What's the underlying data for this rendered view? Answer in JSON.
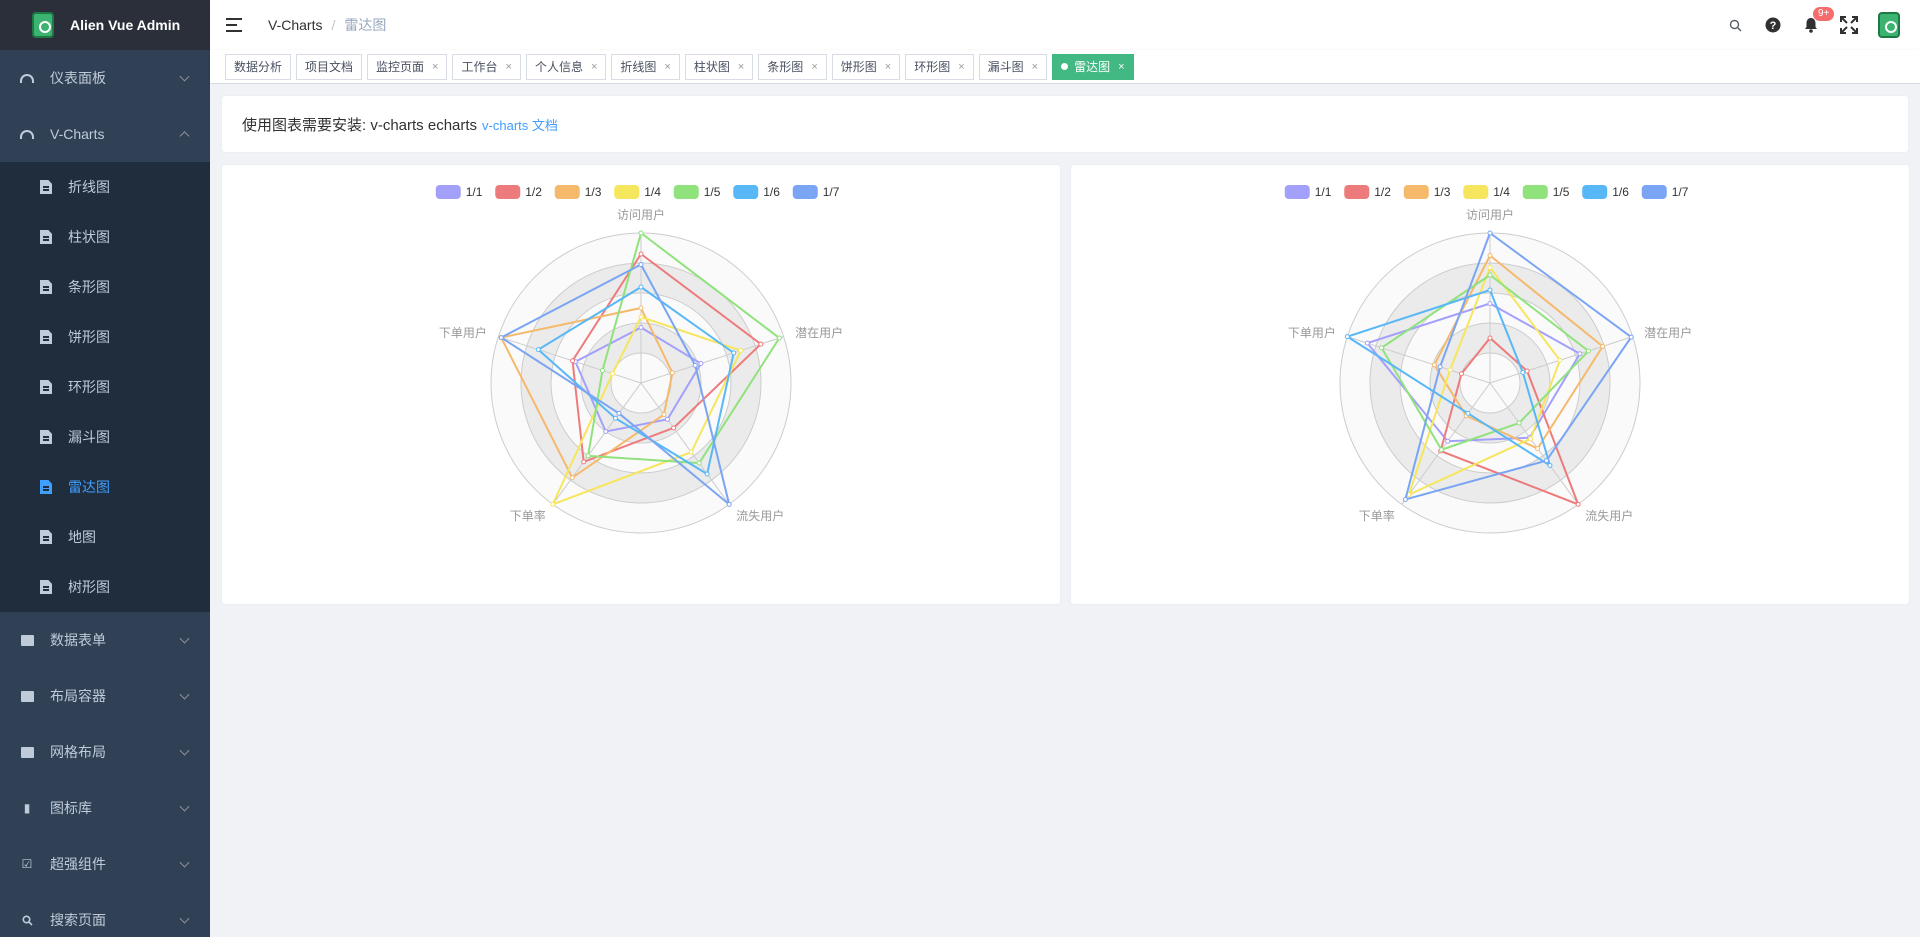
{
  "app": {
    "title": "Alien Vue Admin"
  },
  "sidebar": {
    "groups": [
      {
        "label": "仪表面板",
        "icon": "dashboard-icon",
        "open": false
      },
      {
        "label": "V-Charts",
        "icon": "dashboard-icon",
        "open": true,
        "children": [
          "折线图",
          "柱状图",
          "条形图",
          "饼形图",
          "环形图",
          "漏斗图",
          "雷达图",
          "地图",
          "树形图"
        ]
      },
      {
        "label": "数据表单",
        "icon": "folder-icon",
        "open": false
      },
      {
        "label": "布局容器",
        "icon": "folder-icon",
        "open": false
      },
      {
        "label": "网格布局",
        "icon": "folder-icon",
        "open": false
      },
      {
        "label": "图标库",
        "icon": "icon-library-icon",
        "open": false
      },
      {
        "label": "超强组件",
        "icon": "component-icon",
        "open": false
      },
      {
        "label": "搜索页面",
        "icon": "search-icon",
        "open": false
      }
    ],
    "active_child": "雷达图"
  },
  "header": {
    "breadcrumb": [
      "V-Charts",
      "雷达图"
    ],
    "notification_count": "9+"
  },
  "tags": [
    {
      "label": "数据分析",
      "closable": false,
      "active": false
    },
    {
      "label": "项目文档",
      "closable": false,
      "active": false
    },
    {
      "label": "监控页面",
      "closable": true,
      "active": false
    },
    {
      "label": "工作台",
      "closable": true,
      "active": false
    },
    {
      "label": "个人信息",
      "closable": true,
      "active": false
    },
    {
      "label": "折线图",
      "closable": true,
      "active": false
    },
    {
      "label": "柱状图",
      "closable": true,
      "active": false
    },
    {
      "label": "条形图",
      "closable": true,
      "active": false
    },
    {
      "label": "饼形图",
      "closable": true,
      "active": false
    },
    {
      "label": "环形图",
      "closable": true,
      "active": false
    },
    {
      "label": "漏斗图",
      "closable": true,
      "active": false
    },
    {
      "label": "雷达图",
      "closable": true,
      "active": true
    }
  ],
  "notice": {
    "text": "使用图表需要安装: v-charts echarts",
    "link": "v-charts 文档"
  },
  "chart_data": [
    {
      "type": "radar",
      "indicators": [
        "访问用户",
        "潜在用户",
        "流失用户",
        "下单率",
        "下单用户"
      ],
      "max": 1,
      "legend_position": "top-center",
      "series": [
        {
          "name": "1/1",
          "color": "#a3a0fb",
          "values": [
            0.37,
            0.42,
            0.3,
            0.4,
            0.46
          ]
        },
        {
          "name": "1/2",
          "color": "#ee7b7b",
          "values": [
            0.86,
            0.84,
            0.37,
            0.65,
            0.48
          ]
        },
        {
          "name": "1/3",
          "color": "#f5b96c",
          "values": [
            0.5,
            0.22,
            0.26,
            0.78,
            0.98
          ]
        },
        {
          "name": "1/4",
          "color": "#f6e65d",
          "values": [
            0.44,
            0.7,
            0.57,
            1.0,
            0.2
          ]
        },
        {
          "name": "1/5",
          "color": "#8fe27c",
          "values": [
            1.0,
            0.97,
            0.66,
            0.6,
            0.27
          ]
        },
        {
          "name": "1/6",
          "color": "#58b8f7",
          "values": [
            0.64,
            0.65,
            0.75,
            0.29,
            0.72
          ]
        },
        {
          "name": "1/7",
          "color": "#7aa5f4",
          "values": [
            0.79,
            0.38,
            1.0,
            0.25,
            0.98
          ]
        }
      ]
    },
    {
      "type": "radar",
      "indicators": [
        "访问用户",
        "潜在用户",
        "流失用户",
        "下单率",
        "下单用户"
      ],
      "max": 1,
      "legend_position": "top-center",
      "series": [
        {
          "name": "1/1",
          "color": "#a3a0fb",
          "values": [
            0.53,
            0.63,
            0.45,
            0.48,
            0.86
          ]
        },
        {
          "name": "1/2",
          "color": "#ee7b7b",
          "values": [
            0.3,
            0.26,
            1.0,
            0.56,
            0.2
          ]
        },
        {
          "name": "1/3",
          "color": "#f5b96c",
          "values": [
            0.85,
            0.79,
            0.54,
            0.27,
            0.39
          ]
        },
        {
          "name": "1/4",
          "color": "#f6e65d",
          "values": [
            0.77,
            0.49,
            0.46,
            0.92,
            0.28
          ]
        },
        {
          "name": "1/5",
          "color": "#8fe27c",
          "values": [
            0.72,
            0.69,
            0.33,
            0.55,
            0.76
          ]
        },
        {
          "name": "1/6",
          "color": "#58b8f7",
          "values": [
            0.62,
            0.23,
            0.68,
            0.25,
            1.0
          ]
        },
        {
          "name": "1/7",
          "color": "#7aa5f4",
          "values": [
            1.0,
            0.99,
            0.64,
            0.96,
            0.35
          ]
        }
      ]
    }
  ]
}
